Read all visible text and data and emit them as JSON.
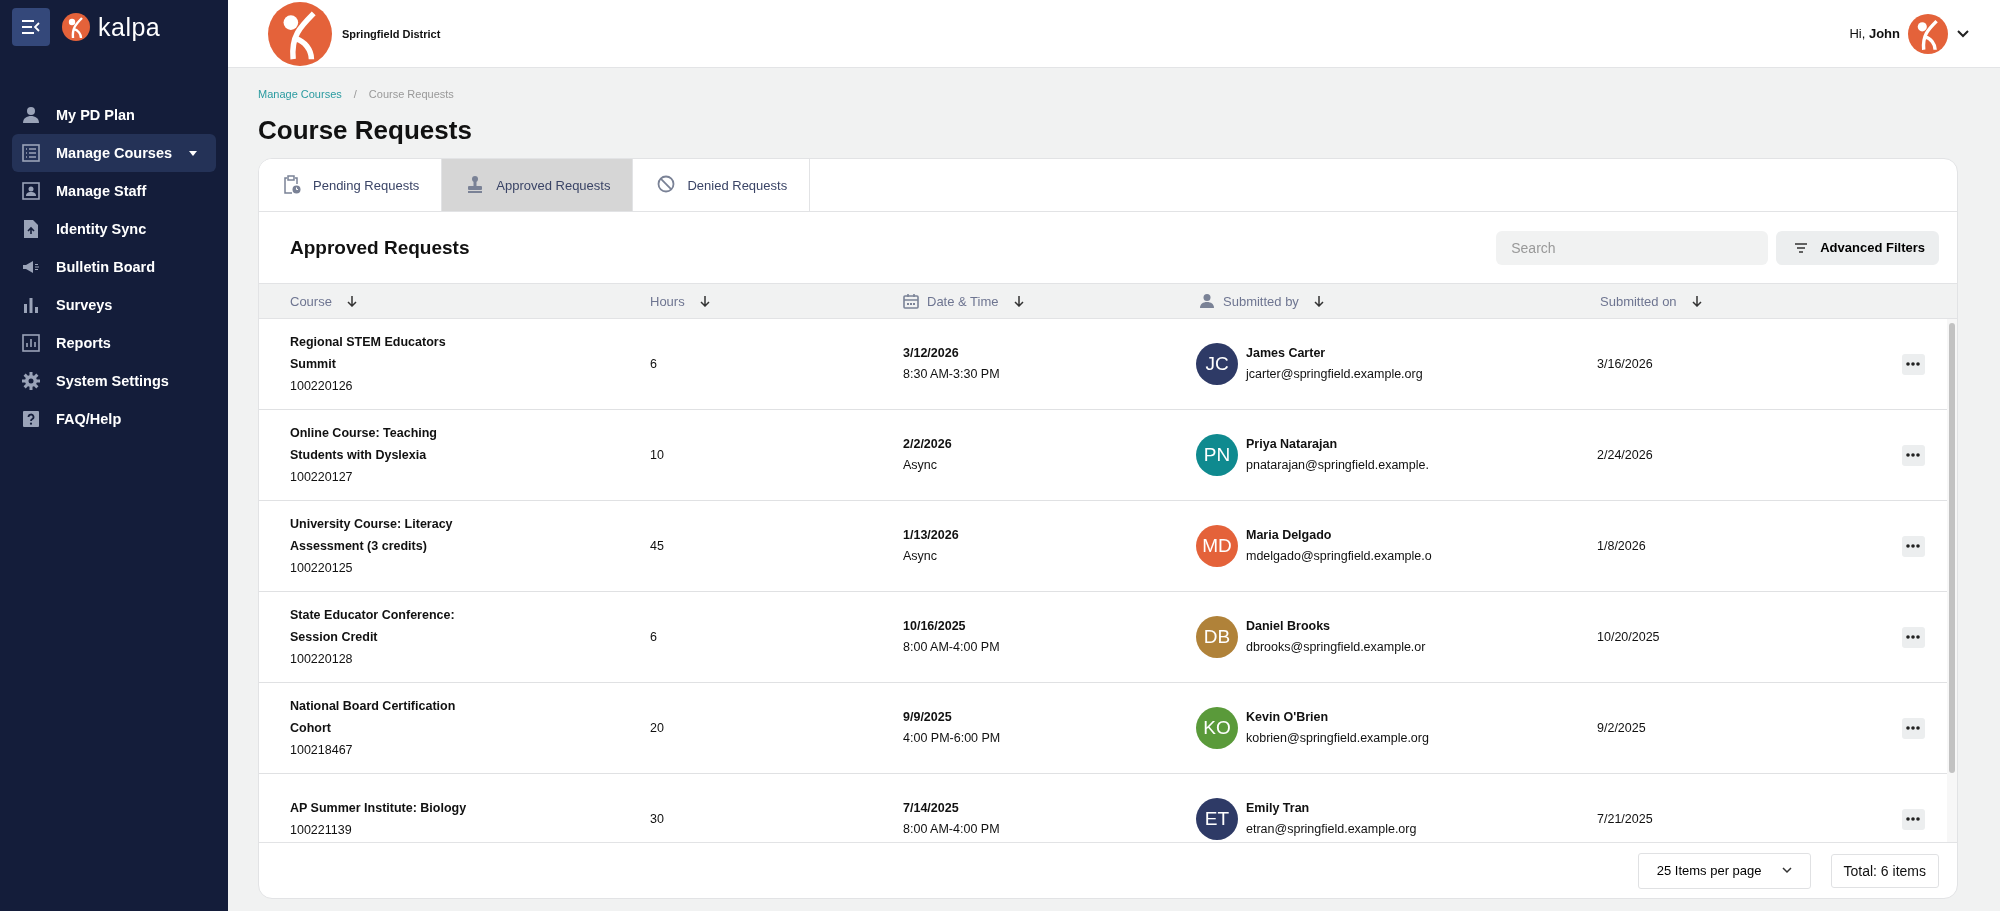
{
  "sidebar": {
    "brand": "kalpa",
    "items": [
      {
        "label": "My PD Plan",
        "selected": false,
        "has_caret": false
      },
      {
        "label": "Manage Courses",
        "selected": true,
        "has_caret": true
      },
      {
        "label": "Manage Staff",
        "selected": false,
        "has_caret": false
      },
      {
        "label": "Identity Sync",
        "selected": false,
        "has_caret": false
      },
      {
        "label": "Bulletin Board",
        "selected": false,
        "has_caret": false
      },
      {
        "label": "Surveys",
        "selected": false,
        "has_caret": false
      },
      {
        "label": "Reports",
        "selected": false,
        "has_caret": false
      },
      {
        "label": "System Settings",
        "selected": false,
        "has_caret": false
      },
      {
        "label": "FAQ/Help",
        "selected": false,
        "has_caret": false
      }
    ]
  },
  "header": {
    "district": "Springfield District",
    "greeting": "Hi, **John**"
  },
  "breadcrumb": {
    "separator": "/",
    "items": [
      {
        "label": "Manage Courses",
        "link": true
      },
      {
        "label": "Course Requests",
        "link": false
      }
    ]
  },
  "page_title": "Course Requests",
  "tabs": [
    {
      "label": "Pending Requests",
      "selected": false
    },
    {
      "label": "Approved Requests",
      "selected": true
    },
    {
      "label": "Denied Requests",
      "selected": false
    }
  ],
  "section_title": "Approved Requests",
  "search": {
    "placeholder": "Search"
  },
  "filters_button": "Advanced Filters",
  "table": {
    "columns": [
      "Course",
      "Hours",
      "Date & Time",
      "Submitted by",
      "Submitted on"
    ],
    "rows": [
      {
        "course": "Regional STEM Educators Summit",
        "course_id": "100220126",
        "hours": "6",
        "date": "3/12/2026",
        "time": "8:30 AM-3:30 PM",
        "initials": "JC",
        "color": "#2e3a66",
        "name": "James Carter",
        "email": "jcarter@springfield.example.org",
        "submitted_on": "3/16/2026"
      },
      {
        "course": "Online Course: Teaching Students with Dyslexia",
        "course_id": "100220127",
        "hours": "10",
        "date": "2/2/2026",
        "time": "Async",
        "initials": "PN",
        "color": "#0f8a8f",
        "name": "Priya Natarajan",
        "email": "pnatarajan@springfield.example.",
        "submitted_on": "2/24/2026"
      },
      {
        "course": "University Course: Literacy Assessment (3 credits)",
        "course_id": "100220125",
        "hours": "45",
        "date": "1/13/2026",
        "time": "Async",
        "initials": "MD",
        "color": "#e4623a",
        "name": "Maria Delgado",
        "email": "mdelgado@springfield.example.o",
        "submitted_on": "1/8/2026"
      },
      {
        "course": "State Educator Conference: Session Credit",
        "course_id": "100220128",
        "hours": "6",
        "date": "10/16/2025",
        "time": "8:00 AM-4:00 PM",
        "initials": "DB",
        "color": "#b08239",
        "name": "Daniel Brooks",
        "email": "dbrooks@springfield.example.or",
        "submitted_on": "10/20/2025"
      },
      {
        "course": "National Board Certification Cohort",
        "course_id": "100218467",
        "hours": "20",
        "date": "9/9/2025",
        "time": "4:00 PM-6:00 PM",
        "initials": "KO",
        "color": "#5a9a3a",
        "name": "Kevin O'Brien",
        "email": "kobrien@springfield.example.org",
        "submitted_on": "9/2/2025"
      },
      {
        "course": "AP Summer Institute: Biology",
        "course_id": "100221139",
        "hours": "30",
        "date": "7/14/2025",
        "time": "8:00 AM-4:00 PM",
        "initials": "ET",
        "color": "#2e3a66",
        "name": "Emily Tran",
        "email": "etran@springfield.example.org",
        "submitted_on": "7/21/2025"
      }
    ]
  },
  "pagination": {
    "per_page": "25 Items per page",
    "total": "Total: 6 items"
  }
}
